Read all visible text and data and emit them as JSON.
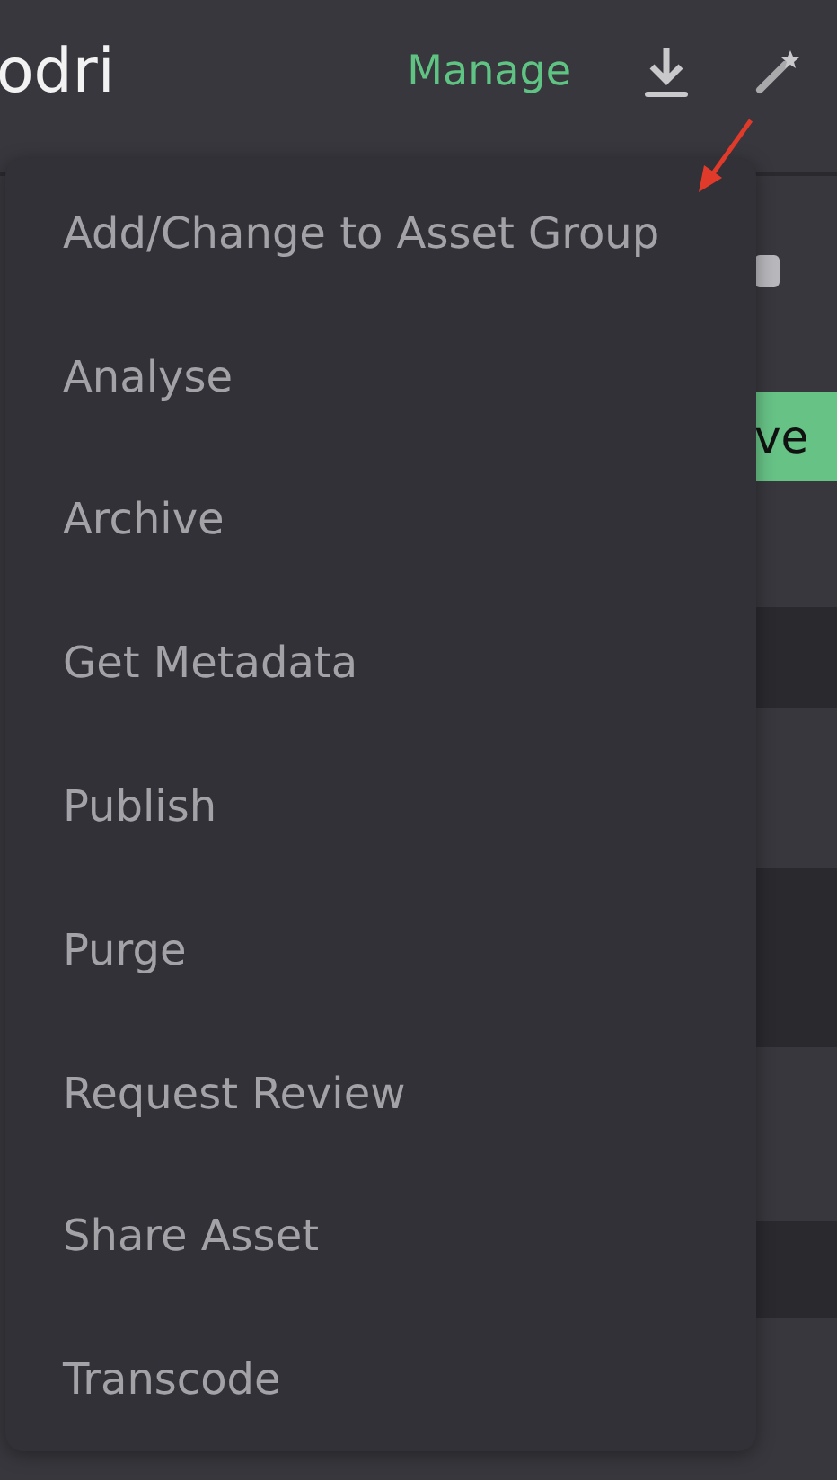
{
  "header": {
    "title": "odri",
    "action": "Manage"
  },
  "background": {
    "button_label": "ve"
  },
  "menu": {
    "items": [
      {
        "label": "Add/Change to Asset Group"
      },
      {
        "label": "Analyse"
      },
      {
        "label": "Archive"
      },
      {
        "label": "Get Metadata"
      },
      {
        "label": "Publish"
      },
      {
        "label": "Purge"
      },
      {
        "label": "Request Review"
      },
      {
        "label": "Share Asset"
      },
      {
        "label": "Transcode"
      }
    ]
  }
}
